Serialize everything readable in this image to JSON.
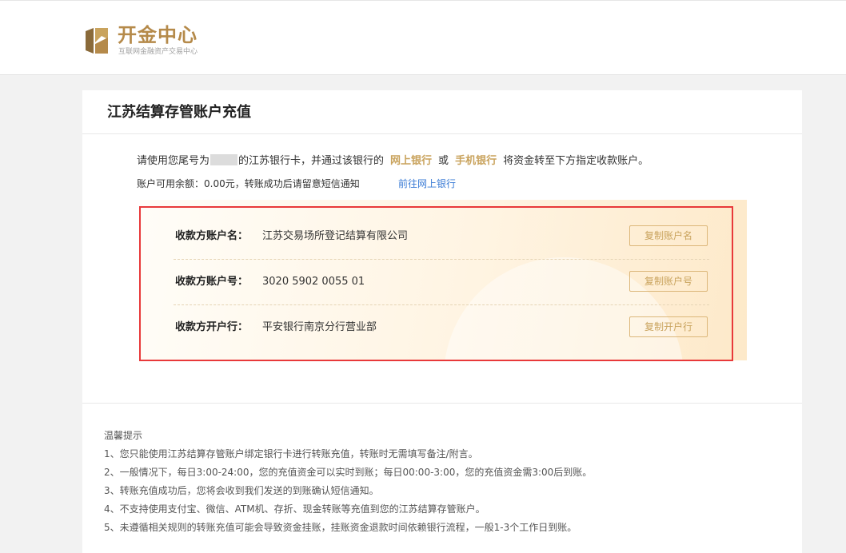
{
  "header": {
    "logo_title": "开金中心",
    "logo_subtitle": "互联网金融资产交易中心",
    "brand_color": "#b58a4a"
  },
  "card": {
    "title": "江苏结算存管账户充值",
    "instruction": {
      "part1": "请使用您尾号为",
      "part2": "的江苏银行卡，并通过该银行的",
      "online_bank": "网上银行",
      "or": "或",
      "mobile_bank": "手机银行",
      "part3": "将资金转至下方指定收款账户。"
    },
    "balance_text": "账户可用余额：0.00元，转账成功后请留意短信通知",
    "bank_link": "前往网上银行",
    "accounts": [
      {
        "label": "收款方账户名：",
        "value": "江苏交易场所登记结算有限公司",
        "button": "复制账户名"
      },
      {
        "label": "收款方账户号：",
        "value": "3020 5902 0055 01",
        "button": "复制账户号"
      },
      {
        "label": "收款方开户行：",
        "value": "平安银行南京分行营业部",
        "button": "复制开户行"
      }
    ],
    "highlight_color": "#c9a35d",
    "frame_color": "#e8393a"
  },
  "tips": {
    "title": "温馨提示",
    "items": [
      "1、您只能使用江苏结算存管账户绑定银行卡进行转账充值，转账时无需填写备注/附言。",
      "2、一般情况下，每日3:00-24:00，您的充值资金可以实时到账；每日00:00-3:00，您的充值资金需3:00后到账。",
      "3、转账充值成功后，您将会收到我们发送的到账确认短信通知。",
      "4、不支持使用支付宝、微信、ATM机、存折、现金转账等充值到您的江苏结算存管账户。",
      "5、未遵循相关规则的转账充值可能会导致资金挂账，挂账资金退款时间依赖银行流程，一般1-3个工作日到账。"
    ]
  }
}
